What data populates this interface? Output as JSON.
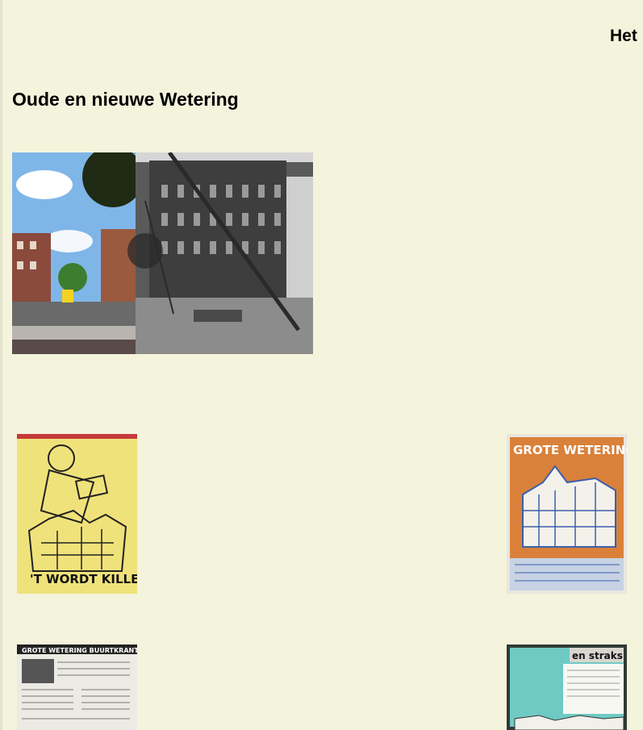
{
  "header": {
    "corner_title": "Het",
    "page_title": "Oude en nieuwe Wetering"
  },
  "images": {
    "hero": {
      "icon": "then-and-now-photo"
    },
    "poster_left": {
      "icon": "poster-photo",
      "lettering": "'T WORDT KILLER..."
    },
    "poster_right": {
      "icon": "poster-photo",
      "lettering": "GROTE WETERING"
    },
    "newspaper": {
      "icon": "newspaper-photo",
      "lettering": "GROTE WETERING BUURTKRANT"
    },
    "scrapbook": {
      "icon": "scrapbook-photo",
      "lettering": "en straks"
    }
  },
  "colors": {
    "background": "#f4f3dc",
    "poster_yellow": "#f0e27a",
    "poster_orange": "#d9813a",
    "ink_blue": "#3b5fae",
    "teal": "#6fcac4"
  }
}
